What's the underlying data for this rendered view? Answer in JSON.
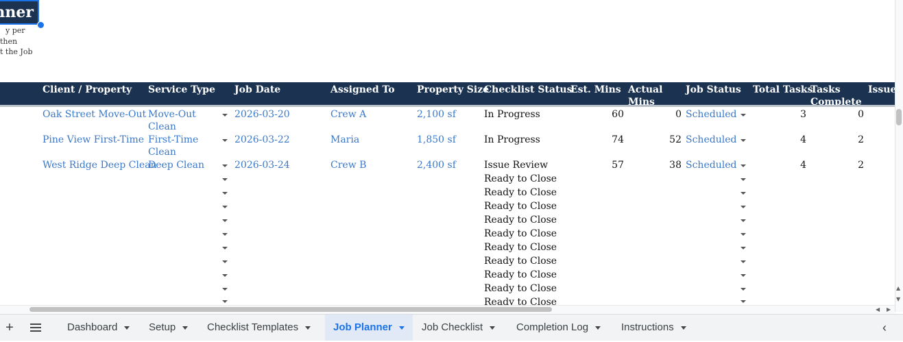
{
  "title": "nner",
  "note_lines": [
    "y per",
    "then",
    "t the Job"
  ],
  "headers": [
    "Client / Property",
    "Service Type",
    "Job Date",
    "Assigned To",
    "Property Size",
    "Checklist Status",
    "Est. Mins",
    "Actual Mins",
    "Job Status",
    "Total Tasks",
    "Tasks Complete",
    "Issues"
  ],
  "rows": [
    {
      "client": "Oak Street Move-Out",
      "service": [
        "Move-Out",
        "Clean"
      ],
      "date": "2026-03-20",
      "assigned": "Crew A",
      "size": "2,100 sf",
      "checklist": "In Progress",
      "est": "60",
      "actual": "0",
      "status": "Scheduled",
      "total": "3",
      "complete": "0"
    },
    {
      "client": "Pine View First-Time",
      "service": [
        "First-Time",
        "Clean"
      ],
      "date": "2026-03-22",
      "assigned": "Maria",
      "size": "1,850 sf",
      "checklist": "In Progress",
      "est": "74",
      "actual": "52",
      "status": "Scheduled",
      "total": "4",
      "complete": "2"
    },
    {
      "client": "West Ridge Deep Clean",
      "service": [
        "Deep Clean"
      ],
      "date": "2026-03-24",
      "assigned": "Crew B",
      "size": "2,400 sf",
      "checklist": "Issue Review",
      "est": "57",
      "actual": "38",
      "status": "Scheduled",
      "total": "4",
      "complete": "2"
    }
  ],
  "empty_checklist_status": [
    "Ready to Close",
    "Ready to Close",
    "Ready to Close",
    "Ready to Close",
    "Ready to Close",
    "Ready to Close",
    "Ready to Close",
    "Ready to Close",
    "Ready to Close",
    "Ready to Close"
  ],
  "tabs": [
    {
      "label": "Dashboard",
      "active": false
    },
    {
      "label": "Setup",
      "active": false
    },
    {
      "label": "Checklist Templates",
      "active": false
    },
    {
      "label": "Job Planner",
      "active": true
    },
    {
      "label": "Job Checklist",
      "active": false
    },
    {
      "label": "Completion Log",
      "active": false
    },
    {
      "label": "Instructions",
      "active": false
    }
  ],
  "icons": {
    "add_sheet": "plus-icon",
    "all_sheets": "menu-icon",
    "scroll_tabs": "chevron-left-icon"
  },
  "colors": {
    "header_bg": "#1b3350",
    "link": "#3a78c9",
    "active_tab": "#1a73e8"
  }
}
